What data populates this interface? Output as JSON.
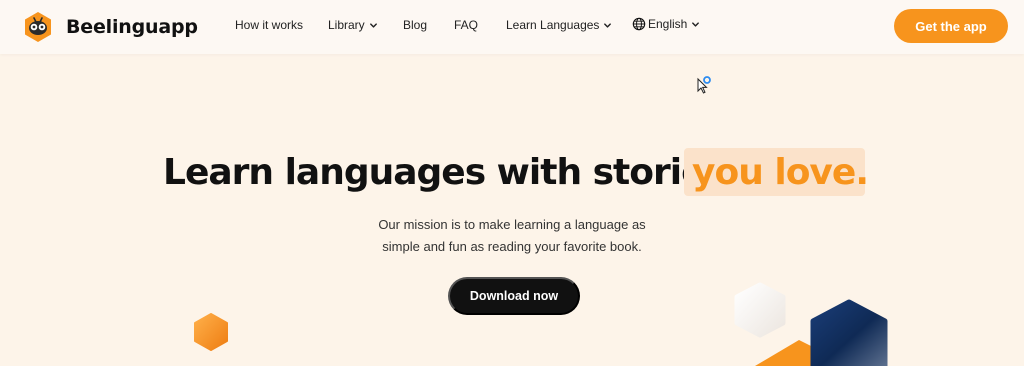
{
  "header": {
    "brand": "Beelinguapp",
    "nav": [
      {
        "label": "How it works",
        "has_dropdown": false
      },
      {
        "label": "Library",
        "has_dropdown": true
      },
      {
        "label": "Blog",
        "has_dropdown": false
      },
      {
        "label": "FAQ",
        "has_dropdown": false
      },
      {
        "label": "Learn Languages",
        "has_dropdown": true
      }
    ],
    "language": {
      "label": "English",
      "icon": "globe-icon"
    },
    "cta_label": "Get the app"
  },
  "hero": {
    "headline_main": "Learn languages with stories",
    "headline_accent": "you love.",
    "mission_line1": "Our mission is to make learning a language as",
    "mission_line2": "simple and fun as reading your favorite book.",
    "download_label": "Download now"
  },
  "colors": {
    "accent": "#f7941d",
    "background": "#fdf4e9",
    "highlight": "#fbe2ca",
    "dark": "#111111",
    "navy": "#0f2a55"
  }
}
